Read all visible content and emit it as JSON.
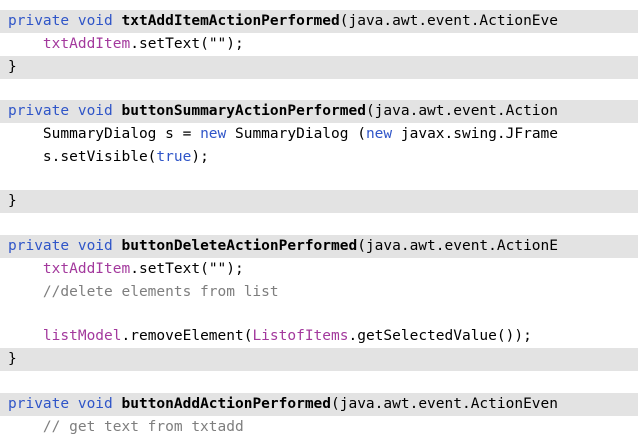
{
  "code": {
    "b1": {
      "sig_kw1": "private",
      "sig_kw2": "void",
      "sig_name": "txtAddItemActionPerformed",
      "sig_rest": "(java.awt.event.ActionEve",
      "l1_field": "txtAddItem",
      "l1_rest": ".setText(",
      "l1_str": "\"\"",
      "l1_end": ");",
      "close": "}"
    },
    "b2": {
      "sig_kw1": "private",
      "sig_kw2": "void",
      "sig_name": "buttonSummaryActionPerformed",
      "sig_rest": "(java.awt.event.Action",
      "l1_a": "SummaryDialog s = ",
      "l1_kw": "new",
      "l1_b": " SummaryDialog (",
      "l1_kw2": "new",
      "l1_c": " javax.swing.JFrame",
      "l2_a": "s.setVisible(",
      "l2_kw": "true",
      "l2_b": ");",
      "close": "}"
    },
    "b3": {
      "sig_kw1": "private",
      "sig_kw2": "void",
      "sig_name": "buttonDeleteActionPerformed",
      "sig_rest": "(java.awt.event.ActionE",
      "l1_field": "txtAddItem",
      "l1_rest": ".setText(",
      "l1_str": "\"\"",
      "l1_end": ");",
      "comment": "//delete elements from list",
      "l3_field": "listModel",
      "l3_mid": ".removeElement(",
      "l3_field2": "ListofItems",
      "l3_end": ".getSelectedValue());",
      "close": "}"
    },
    "b4": {
      "sig_kw1": "private",
      "sig_kw2": "void",
      "sig_name": "buttonAddActionPerformed",
      "sig_rest": "(java.awt.event.ActionEven",
      "comment": "// get text from txtadd"
    }
  },
  "colors": {
    "keyword": "#2f55c8",
    "field": "#a3399d",
    "comment": "#7e7e7e",
    "shade": "#e3e3e3"
  }
}
